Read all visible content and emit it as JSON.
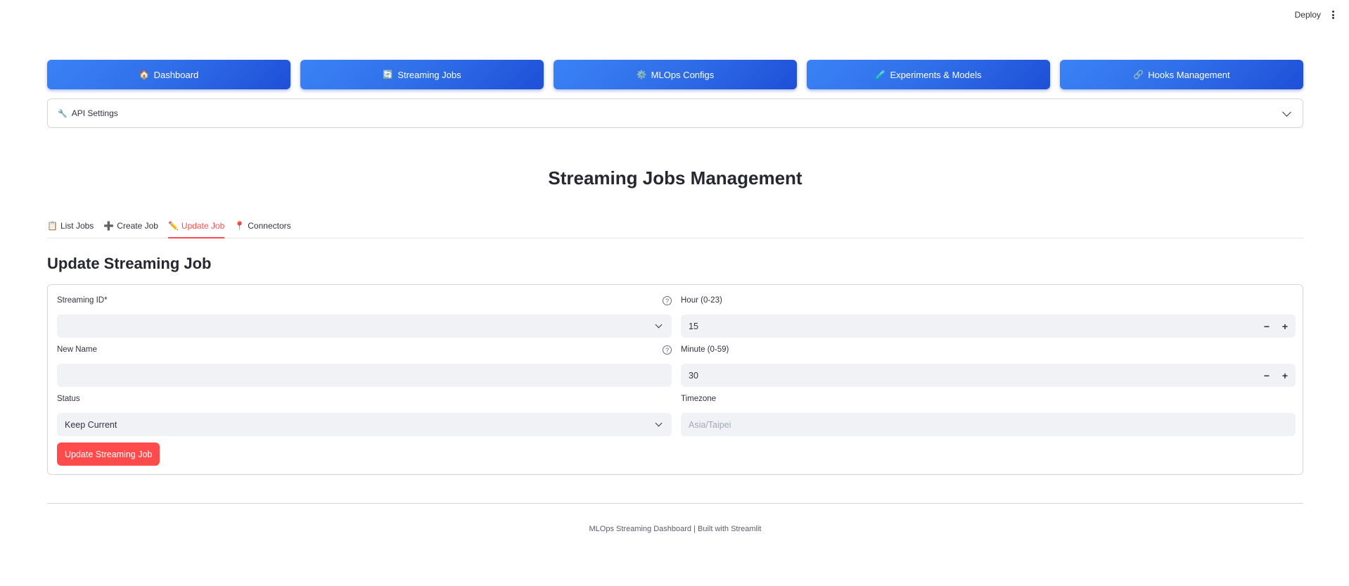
{
  "topbar": {
    "deploy_label": "Deploy",
    "menu_icon": "more-vertical-icon"
  },
  "nav": [
    {
      "icon": "🏠",
      "label": "Dashboard"
    },
    {
      "icon": "🔄",
      "label": "Streaming Jobs"
    },
    {
      "icon": "⚙️",
      "label": "MLOps Configs"
    },
    {
      "icon": "🧪",
      "label": "Experiments & Models"
    },
    {
      "icon": "🔗",
      "label": "Hooks Management"
    }
  ],
  "api_settings": {
    "icon": "🔧",
    "label": "API Settings"
  },
  "page_title": "Streaming Jobs Management",
  "tabs": [
    {
      "icon": "📋",
      "label": "List Jobs"
    },
    {
      "icon": "➕",
      "label": "Create Job"
    },
    {
      "icon": "✏️",
      "label": "Update Job"
    },
    {
      "icon": "📍",
      "label": "Connectors"
    }
  ],
  "active_tab": "Update Job",
  "section_title": "Update Streaming Job",
  "form": {
    "streaming_id": {
      "label": "Streaming ID*",
      "value": ""
    },
    "new_name": {
      "label": "New Name",
      "value": ""
    },
    "status": {
      "label": "Status",
      "value": "Keep Current"
    },
    "hour": {
      "label": "Hour (0-23)",
      "value": "15",
      "minus": "−",
      "plus": "+"
    },
    "minute": {
      "label": "Minute (0-59)",
      "value": "30",
      "minus": "−",
      "plus": "+"
    },
    "timezone": {
      "label": "Timezone",
      "placeholder": "Asia/Taipei"
    },
    "submit_label": "Update Streaming Job"
  },
  "footer": "MLOps Streaming Dashboard | Built with Streamlit",
  "colors": {
    "accent": "#ff4b4b",
    "nav_blue": "#2f6ee8",
    "input_bg": "#f0f2f6"
  }
}
